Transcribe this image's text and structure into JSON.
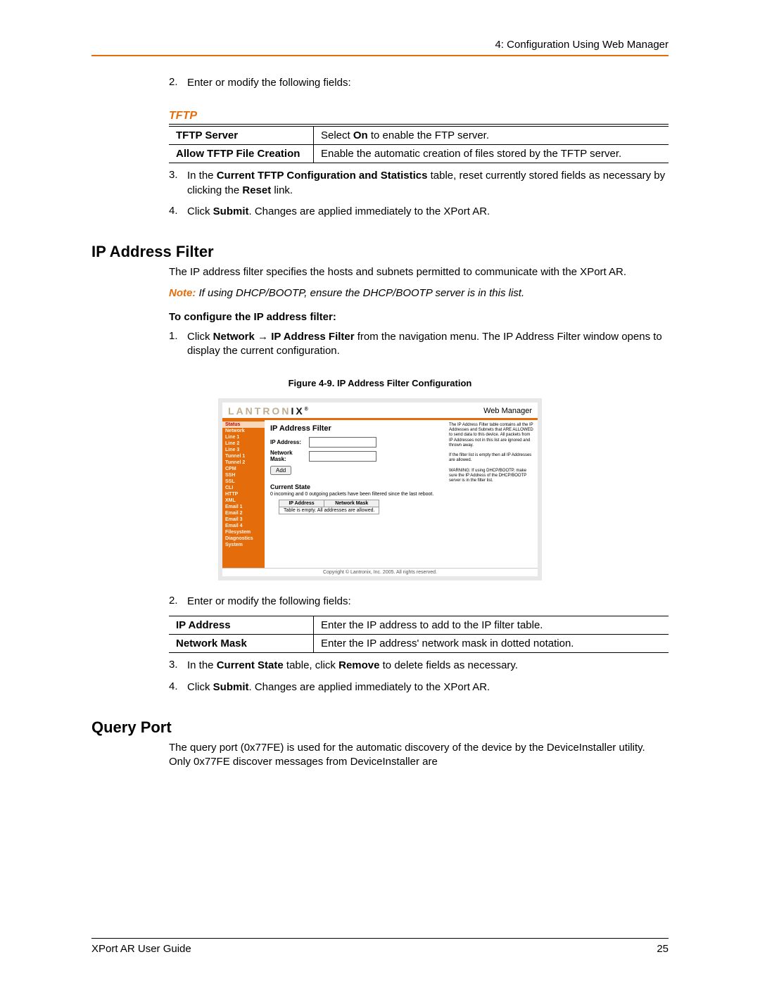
{
  "header": {
    "chapter": "4: Configuration Using Web Manager"
  },
  "step2": {
    "num": "2.",
    "text": "Enter or modify the following fields:"
  },
  "tftp": {
    "heading": "TFTP",
    "rows": [
      {
        "label": "TFTP Server",
        "desc_pre": "Select ",
        "desc_bold": "On",
        "desc_post": " to enable the FTP server."
      },
      {
        "label": "Allow TFTP File Creation",
        "desc": "Enable the automatic creation of files stored by the TFTP server."
      }
    ]
  },
  "step3": {
    "num": "3.",
    "pre": "In the ",
    "bold1": "Current TFTP Configuration and Statistics",
    "mid": " table, reset currently stored fields as necessary by clicking the ",
    "bold2": "Reset",
    "post": " link."
  },
  "step4": {
    "num": "4.",
    "pre": "Click ",
    "bold": "Submit",
    "post": ". Changes are applied immediately to the XPort AR."
  },
  "ipfilter": {
    "heading": "IP Address Filter",
    "body": "The IP address filter specifies the hosts and subnets permitted to communicate with the XPort AR.",
    "note_label": "Note:",
    "note_text": " If using DHCP/BOOTP, ensure the DHCP/BOOTP server is in this list.",
    "conf_label": "To configure the IP address filter:",
    "step1": {
      "num": "1.",
      "pre": "Click ",
      "bold1": "Network",
      "arrow": " → ",
      "bold2": "IP Address Filter",
      "post": " from the navigation menu. The IP Address Filter window opens to display the current configuration."
    },
    "fig_caption": "Figure 4-9. IP Address Filter Configuration",
    "table": {
      "rows": [
        {
          "label": "IP Address",
          "desc": "Enter the IP address to add to the IP filter table."
        },
        {
          "label": "Network Mask",
          "desc": "Enter the IP address' network mask in dotted notation."
        }
      ]
    },
    "step2b": {
      "num": "2.",
      "text": "Enter or modify the following fields:"
    },
    "step3b": {
      "num": "3.",
      "pre": "In the ",
      "bold1": "Current State",
      "mid": " table, click ",
      "bold2": "Remove",
      "post": " to delete fields as necessary."
    },
    "step4b": {
      "num": "4.",
      "pre": "Click ",
      "bold": "Submit",
      "post": ". Changes are applied immediately to the XPort AR."
    }
  },
  "queryport": {
    "heading": "Query Port",
    "body": "The query port (0x77FE) is used for the automatic discovery of the device by the DeviceInstaller utility.  Only 0x77FE discover messages from DeviceInstaller are"
  },
  "shot": {
    "logo1": "LANTRON",
    "logo2": "IX",
    "wm": "Web Manager",
    "sidebar": [
      "Status",
      "Network",
      "Line 1",
      "Line 2",
      "Line 3",
      "Tunnel 1",
      "Tunnel 2",
      "CPM",
      "SSH",
      "SSL",
      "CLI",
      "HTTP",
      "XML",
      "Email 1",
      "Email 2",
      "Email 3",
      "Email 4",
      "Filesystem",
      "Diagnostics",
      "System"
    ],
    "title": "IP Address Filter",
    "lbl_ip": "IP Address:",
    "lbl_mask": "Network Mask:",
    "btn_add": "Add",
    "sub": "Current State",
    "packets": "0 incoming and 0 outgoing packets have been filtered since the last reboot.",
    "th_ip": "IP Address",
    "th_mask": "Network Mask",
    "empty": "Table is empty. All addresses are allowed.",
    "help1": "The IP Address Filter table contains all the IP Addresses and Subnets that ARE ALLOWED to send data to this device. All packets from IP Addresses not in this list are ignored and thrown away.",
    "help2": "If the filter list is empty then all IP Addresses are allowed.",
    "help3": "WARNING: If using DHCP/BOOTP, make sure the IP Address of the DHCP/BOOTP server is in the filter list.",
    "copyright": "Copyright © Lantronix, Inc. 2005. All rights reserved."
  },
  "footer": {
    "left": "XPort AR User Guide",
    "right": "25"
  }
}
